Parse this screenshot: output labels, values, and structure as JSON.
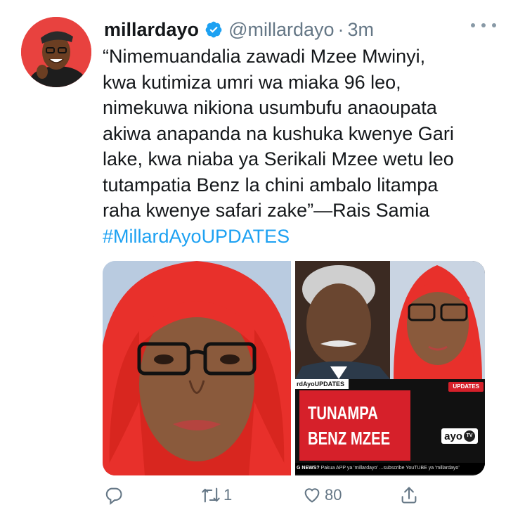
{
  "tweet": {
    "display_name": "millardayo",
    "handle": "@millardayo",
    "separator": "·",
    "time": "3m",
    "text_lines": [
      "“Nimemuandalia zawadi Mzee Mwinyi,",
      "kwa kutimiza umri wa miaka 96 leo,",
      "nimekuwa nikiona usumbufu anaoupata",
      "akiwa anapanda na kushuka kwenye Gari",
      "lake, kwa niaba ya Serikali Mzee wetu leo",
      "tutampatia Benz la chini ambalo litampa",
      "raha kwenye safari zake”—Rais Samia"
    ],
    "hashtag": "#MillardAyoUPDATES"
  },
  "media": {
    "banner_tag": "rdAyoUPDATES",
    "banner_updates": "UPDATES",
    "banner_line_1": "TUNAMPA",
    "banner_line_2": "BENZ MZEE",
    "logo_text": "ayo",
    "logo_tv": "TV",
    "ticker_bold": "G NEWS?",
    "ticker_text": " Pakua APP ya 'millardayo' ...subscribe YouTUBE ya 'millardayo'"
  },
  "actions": {
    "reply_count": "",
    "retweet_count": "1",
    "like_count": "80"
  },
  "icons": {
    "verified": "verified-badge-icon",
    "more": "more-dots-icon",
    "reply": "reply-icon",
    "retweet": "retweet-icon",
    "like": "heart-icon",
    "share": "share-icon"
  },
  "colors": {
    "accent": "#1da1f2",
    "muted": "#657786",
    "text": "#14171a",
    "banner_red": "#d6202a"
  }
}
